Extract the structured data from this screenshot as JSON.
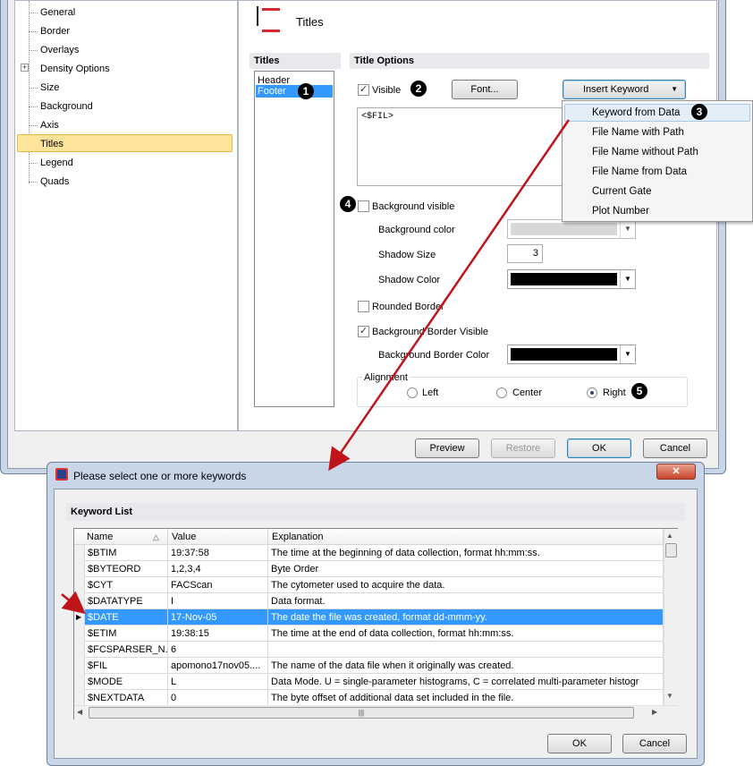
{
  "tree": {
    "items": [
      {
        "label": "General",
        "expander": false,
        "selected": false
      },
      {
        "label": "Border",
        "expander": false,
        "selected": false
      },
      {
        "label": "Overlays",
        "expander": false,
        "selected": false
      },
      {
        "label": "Density Options",
        "expander": true,
        "selected": false
      },
      {
        "label": "Size",
        "expander": false,
        "selected": false
      },
      {
        "label": "Background",
        "expander": false,
        "selected": false
      },
      {
        "label": "Axis",
        "expander": false,
        "selected": false
      },
      {
        "label": "Titles",
        "expander": false,
        "selected": true
      },
      {
        "label": "Legend",
        "expander": false,
        "selected": false
      },
      {
        "label": "Quads",
        "expander": false,
        "selected": false
      }
    ]
  },
  "page": {
    "title": "Titles",
    "icon": "titles-icon",
    "accent": "#d9282f"
  },
  "titles_list": {
    "header": "Titles",
    "items": [
      {
        "label": "Header",
        "selected": false
      },
      {
        "label": "Footer",
        "selected": true
      }
    ]
  },
  "options": {
    "header": "Title Options",
    "visible_label": "Visible",
    "visible_checked": true,
    "font_button": "Font...",
    "insert_keyword_button": "Insert Keyword",
    "text_value": "<$FIL>",
    "bg_visible_label": "Background visible",
    "bg_visible_checked": false,
    "bg_color_label": "Background color",
    "bg_color": "#c8c8c8",
    "shadow_size_label": "Shadow Size",
    "shadow_size_value": "3",
    "shadow_color_label": "Shadow Color",
    "shadow_color": "#000000",
    "rounded_border_label": "Rounded Border",
    "rounded_border_checked": false,
    "bg_border_visible_label": "Background Border Visible",
    "bg_border_visible_checked": true,
    "bg_border_color_label": "Background Border Color",
    "bg_border_color": "#000000",
    "alignment_label": "Alignment",
    "align_left": "Left",
    "align_center": "Center",
    "align_right": "Right",
    "align_selected": "Right"
  },
  "keyword_menu": {
    "items": [
      "Keyword from Data",
      "File Name with Path",
      "File Name without Path",
      "File Name from Data",
      "Current Gate",
      "Plot Number"
    ],
    "highlighted": 0
  },
  "badges": {
    "b1": "1",
    "b2": "2",
    "b3": "3",
    "b4": "4",
    "b5": "5"
  },
  "footer_buttons": {
    "preview": "Preview",
    "restore": "Restore",
    "ok": "OK",
    "cancel": "Cancel"
  },
  "keyword_dialog": {
    "title": "Please select one or more keywords",
    "close_glyph": "✕",
    "section": "Keyword List",
    "columns": [
      "Name",
      "Value",
      "Explanation"
    ],
    "sort_glyph": "△",
    "rows": [
      {
        "name": "$BTIM",
        "value": "19:37:58",
        "explanation": "The time at the beginning of data collection, format hh:mm:ss."
      },
      {
        "name": "$BYTEORD",
        "value": "1,2,3,4",
        "explanation": "Byte Order"
      },
      {
        "name": "$CYT",
        "value": "FACScan",
        "explanation": "The cytometer used to acquire the data."
      },
      {
        "name": "$DATATYPE",
        "value": "I",
        "explanation": "Data format."
      },
      {
        "name": "$DATE",
        "value": "17-Nov-05",
        "explanation": "The date the file was created, format dd-mmm-yy."
      },
      {
        "name": "$ETIM",
        "value": "19:38:15",
        "explanation": "The time at the end of data collection, format hh:mm:ss."
      },
      {
        "name": "$FCSPARSER_N...",
        "value": "6",
        "explanation": ""
      },
      {
        "name": "$FIL",
        "value": "apomono17nov05....",
        "explanation": "The name of the data file when it originally was created."
      },
      {
        "name": "$MODE",
        "value": "L",
        "explanation": "Data Mode.  U = single-parameter histograms, C = correlated multi-parameter histogr"
      },
      {
        "name": "$NEXTDATA",
        "value": "0",
        "explanation": "The byte offset of additional data set included in the file."
      }
    ],
    "selected_row": 4,
    "ok": "OK",
    "cancel": "Cancel",
    "scroll_grip": "|||"
  }
}
